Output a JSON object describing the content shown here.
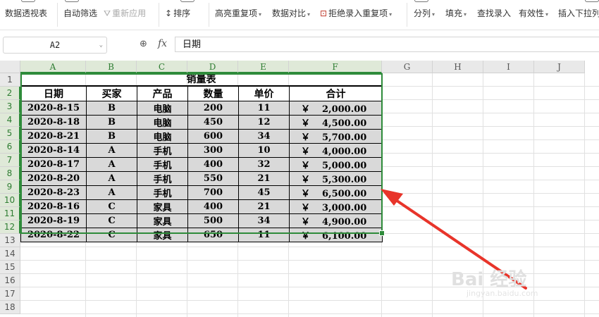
{
  "ribbon": {
    "pivot": "数据透视表",
    "autofilter": "自动筛选",
    "reapply": "重新应用",
    "sort": "排序",
    "highlight_dup": "高亮重复项",
    "compare": "数据对比",
    "reject_dup": "拒绝录入重复项",
    "split": "分列",
    "fill": "填充",
    "lookup": "查找录入",
    "validity": "有效性",
    "insert_dropdown": "插入下拉列"
  },
  "formula_bar": {
    "name_box": "A2",
    "fx": "fx",
    "value": "日期"
  },
  "columns": [
    "A",
    "B",
    "C",
    "D",
    "E",
    "F",
    "G",
    "H",
    "I",
    "J"
  ],
  "rows": [
    "1",
    "2",
    "3",
    "4",
    "5",
    "6",
    "7",
    "8",
    "9",
    "10",
    "11",
    "12",
    "13",
    "14",
    "15",
    "16",
    "17",
    "18"
  ],
  "sheet": {
    "title": "销量表",
    "headers": [
      "日期",
      "买家",
      "产品",
      "数量",
      "单价",
      "合计"
    ],
    "currency": "￥",
    "data": [
      [
        "2020-8-15",
        "B",
        "电脑",
        "200",
        "11",
        "2,000.00"
      ],
      [
        "2020-8-18",
        "B",
        "电脑",
        "450",
        "12",
        "4,500.00"
      ],
      [
        "2020-8-21",
        "B",
        "电脑",
        "600",
        "34",
        "5,700.00"
      ],
      [
        "2020-8-14",
        "A",
        "手机",
        "300",
        "10",
        "4,000.00"
      ],
      [
        "2020-8-17",
        "A",
        "手机",
        "400",
        "32",
        "5,000.00"
      ],
      [
        "2020-8-20",
        "A",
        "手机",
        "550",
        "21",
        "5,300.00"
      ],
      [
        "2020-8-23",
        "A",
        "手机",
        "700",
        "45",
        "6,500.00"
      ],
      [
        "2020-8-16",
        "C",
        "家具",
        "400",
        "21",
        "3,000.00"
      ],
      [
        "2020-8-19",
        "C",
        "家具",
        "500",
        "34",
        "4,900.00"
      ],
      [
        "2020-8-22",
        "C",
        "家具",
        "650",
        "11",
        "6,100.00"
      ]
    ]
  },
  "watermark": {
    "brand": "Bai 经验",
    "url": "jingyan.baidu.com"
  },
  "colors": {
    "selection": "#2e8b3a",
    "arrow": "#e8342a",
    "cell_fill": "#d9d9d9"
  }
}
